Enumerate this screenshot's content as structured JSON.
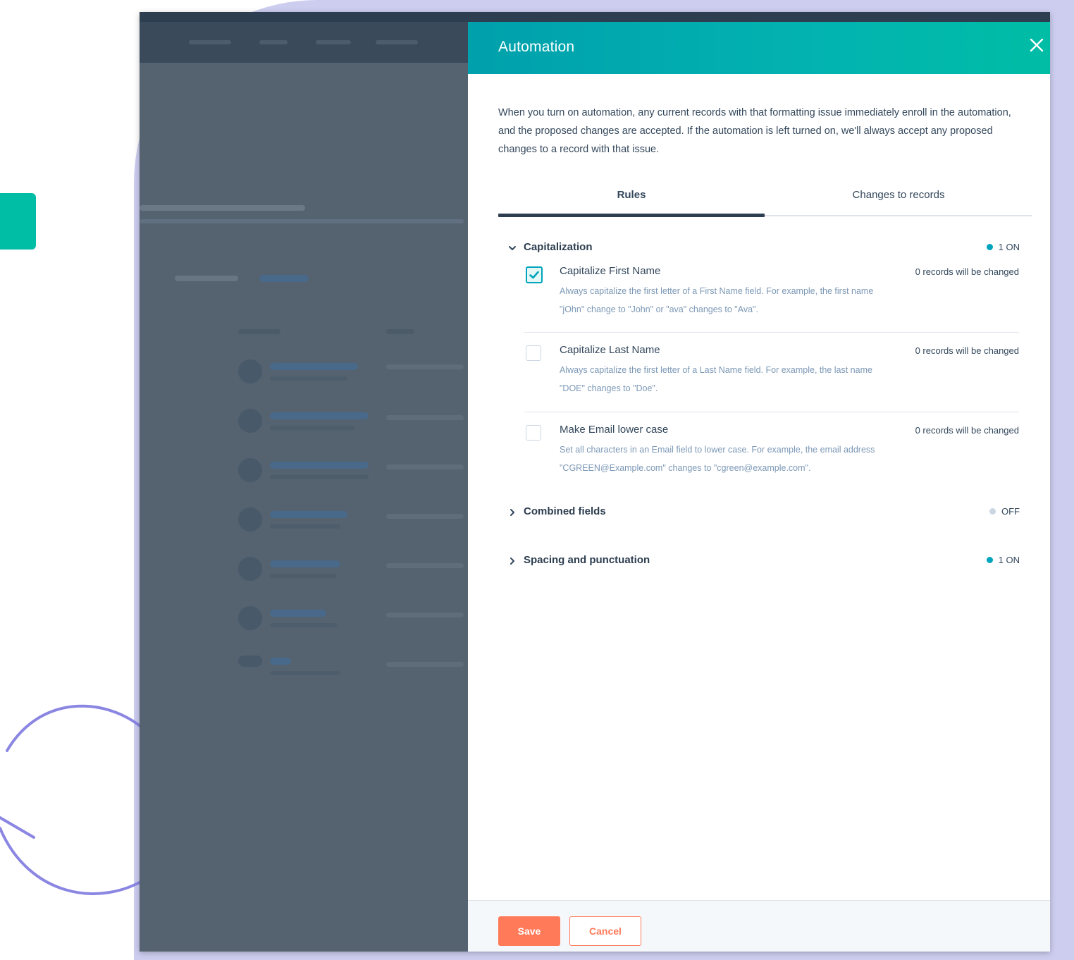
{
  "panel": {
    "title": "Automation",
    "intro": "When you turn on automation, any current records with that formatting issue immediately enroll in the automation, and the proposed changes are accepted. If the automation is left turned on, we'll always accept any proposed changes to a record with that issue."
  },
  "tabs": [
    {
      "label": "Rules",
      "active": true
    },
    {
      "label": "Changes to records",
      "active": false
    }
  ],
  "sections": [
    {
      "title": "Capitalization",
      "expanded": true,
      "status": "1 ON",
      "status_color": "#00a4bd",
      "rules": [
        {
          "name": "Capitalize First Name",
          "description": "Always capitalize the first letter of a First Name field. For example, the first name \"jOhn\" change to \"John\" or \"ava\" changes to \"Ava\".",
          "count": "0 records will be changed",
          "checked": true
        },
        {
          "name": "Capitalize Last Name",
          "description": "Always capitalize the first letter of a Last Name field. For example, the last name \"DOE\" changes to \"Doe\".",
          "count": "0 records will be changed",
          "checked": false
        },
        {
          "name": "Make Email lower case",
          "description": "Set all characters in an Email field to lower case. For example, the email address \"CGREEN@Example.com\" changes to \"cgreen@example.com\".",
          "count": "0 records will be changed",
          "checked": false
        }
      ]
    },
    {
      "title": "Combined fields",
      "expanded": false,
      "status": "OFF",
      "status_color": "#cbd6e2"
    },
    {
      "title": "Spacing and punctuation",
      "expanded": false,
      "status": "1 ON",
      "status_color": "#00a4bd"
    }
  ],
  "footer": {
    "save_label": "Save",
    "cancel_label": "Cancel"
  },
  "colors": {
    "header_teal": "#00a0ac",
    "accent_teal": "#00bda5",
    "primary_orange": "#ff7a59",
    "background_lavender": "#cdcdf0",
    "overlay_slate": "#55626f"
  },
  "icons": {
    "close": "close-icon",
    "expand": "chevron-down-icon",
    "collapse": "chevron-right-icon",
    "check": "check-icon"
  }
}
